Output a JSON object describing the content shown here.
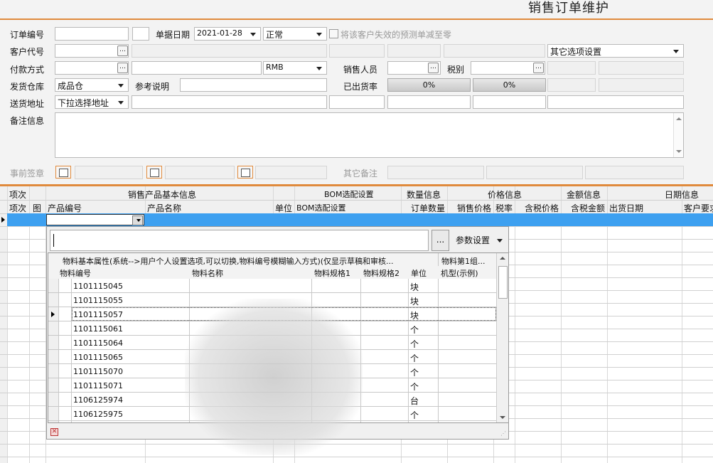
{
  "window": {
    "title": "销售订单维护"
  },
  "header": {
    "order_no_label": "订单编号",
    "order_no_value": "",
    "doc_date_label": "单据日期",
    "doc_date_value": "2021-01-28",
    "status_value": "正常",
    "zero_forecast_label": "将该客户失效的预测单减至零",
    "customer_code_label": "客户代号",
    "other_options_value": "其它选项设置",
    "payment_label": "付款方式",
    "currency_value": "RMB",
    "salesperson_label": "销售人员",
    "tax_type_label": "税别",
    "warehouse_label": "发货仓库",
    "warehouse_value": "成品仓",
    "reference_label": "参考说明",
    "shipped_rate_label": "已出货率",
    "shipped_rate_1": "0%",
    "shipped_rate_2": "0%",
    "ship_addr_label": "送货地址",
    "ship_addr_value": "下拉选择地址",
    "remarks_label": "备注信息",
    "pre_sign_label": "事前签章",
    "other_remarks_label": "其它备注"
  },
  "grid": {
    "group_headers": [
      "项次",
      "销售产品基本信息",
      "BOM选配设置",
      "数量信息",
      "价格信息",
      "金额信息",
      "日期信息"
    ],
    "columns": [
      "项次",
      "图",
      "产品编号",
      "产品名称",
      "单位",
      "BOM选配设置",
      "订单数量",
      "销售价格",
      "税率",
      "含税价格",
      "含税金额",
      "出货日期",
      "客户要求"
    ]
  },
  "popup": {
    "ellipsis_label": "...",
    "param_label": "参数设置",
    "group_header_1": "物料基本属性(系统-->用户个人设置选项,可以切换,物料编号模糊输入方式)(仅显示草稿和审核...",
    "group_header_2": "物料第1组...",
    "columns": [
      "物料编号",
      "物料名称",
      "物料规格1",
      "物料规格2",
      "单位",
      "机型(示例)"
    ],
    "rows": [
      {
        "code": "1101115045",
        "unit": "块"
      },
      {
        "code": "1101115055",
        "unit": "块"
      },
      {
        "code": "1101115057",
        "unit": "块"
      },
      {
        "code": "1101115061",
        "unit": "个"
      },
      {
        "code": "1101115064",
        "unit": "个"
      },
      {
        "code": "1101115065",
        "unit": "个"
      },
      {
        "code": "1101115070",
        "unit": "个"
      },
      {
        "code": "1101115071",
        "unit": "个"
      },
      {
        "code": "1106125974",
        "unit": "台"
      },
      {
        "code": "1106125975",
        "unit": "个"
      }
    ],
    "current_row_index": 2
  }
}
